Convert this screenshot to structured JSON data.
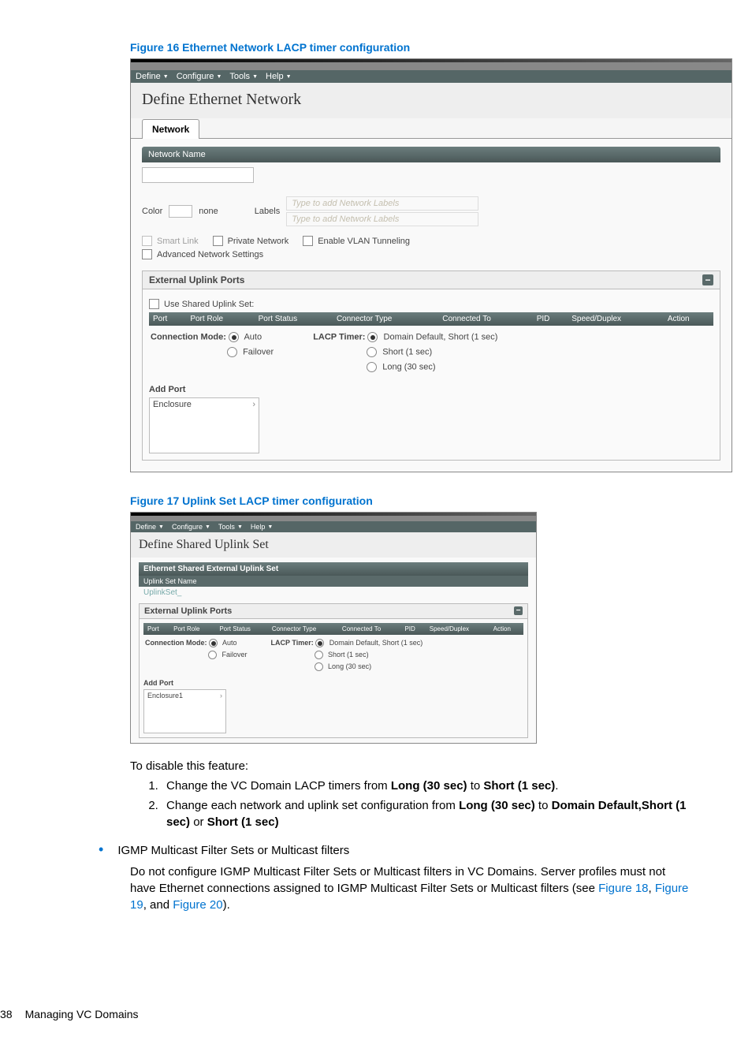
{
  "figure16": {
    "caption": "Figure 16 Ethernet Network LACP timer configuration",
    "menubar": [
      "Define",
      "Configure",
      "Tools",
      "Help"
    ],
    "page_title": "Define Ethernet Network",
    "tab": "Network",
    "net_name_label": "Network Name",
    "color_label": "Color",
    "color_value": "none",
    "labels_label": "Labels",
    "labels_hint1": "Type to add Network Labels",
    "labels_hint2": "Type to add Network Labels",
    "cb_smart": "Smart Link",
    "cb_private": "Private Network",
    "cb_vlan": "Enable VLAN Tunneling",
    "cb_adv": "Advanced Network Settings",
    "ext_ports": "External Uplink Ports",
    "use_shared": "Use Shared Uplink Set:",
    "cols": [
      "Port",
      "Port Role",
      "Port Status",
      "Connector Type",
      "Connected To",
      "PID",
      "Speed/Duplex",
      "Action"
    ],
    "conn_mode": "Connection Mode:",
    "conn_auto": "Auto",
    "conn_failover": "Failover",
    "lacp_label": "LACP Timer:",
    "lacp_opt1": "Domain Default, Short (1 sec)",
    "lacp_opt2": "Short (1 sec)",
    "lacp_opt3": "Long (30 sec)",
    "add_port": "Add Port",
    "enclosure": "Enclosure"
  },
  "figure17": {
    "caption": "Figure 17 Uplink Set LACP timer configuration",
    "menubar": [
      "Define",
      "Configure",
      "Tools",
      "Help"
    ],
    "page_title": "Define Shared Uplink Set",
    "section_title": "Ethernet Shared External Uplink Set",
    "uplink_name_label": "Uplink Set Name",
    "uplink_name_value": "UplinkSet_",
    "ext_ports": "External Uplink Ports",
    "cols": [
      "Port",
      "Port Role",
      "Port Status",
      "Connector Type",
      "Connected To",
      "PID",
      "Speed/Duplex",
      "Action"
    ],
    "conn_mode": "Connection Mode:",
    "conn_auto": "Auto",
    "conn_failover": "Failover",
    "lacp_label": "LACP Timer:",
    "lacp_opt1": "Domain Default, Short (1 sec)",
    "lacp_opt2": "Short (1 sec)",
    "lacp_opt3": "Long (30 sec)",
    "add_port": "Add Port",
    "enclosure": "Enclosure1"
  },
  "text": {
    "disable_intro": "To disable this feature:",
    "step1_a": "Change the VC Domain LACP timers from ",
    "step1_b": "Long (30 sec)",
    "step1_c": " to ",
    "step1_d": "Short (1 sec)",
    "step1_e": ".",
    "step2_a": "Change each network and uplink set configuration from ",
    "step2_b": "Long (30 sec)",
    "step2_c": " to ",
    "step2_d": "Domain Default,Short (1 sec)",
    "step2_e": " or ",
    "step2_f": "Short (1 sec)",
    "bullet": "IGMP Multicast Filter Sets or Multicast filters",
    "para_a": "Do not configure IGMP Multicast Filter Sets or Multicast filters in VC Domains. Server profiles must not have Ethernet connections assigned to IGMP Multicast Filter Sets or Multicast filters (see ",
    "link1": "Figure 18",
    "sep1": ", ",
    "link2": "Figure 19",
    "sep2": ", and ",
    "link3": "Figure 20",
    "para_end": ").",
    "page_number": "38",
    "footer_text": "Managing VC Domains"
  }
}
